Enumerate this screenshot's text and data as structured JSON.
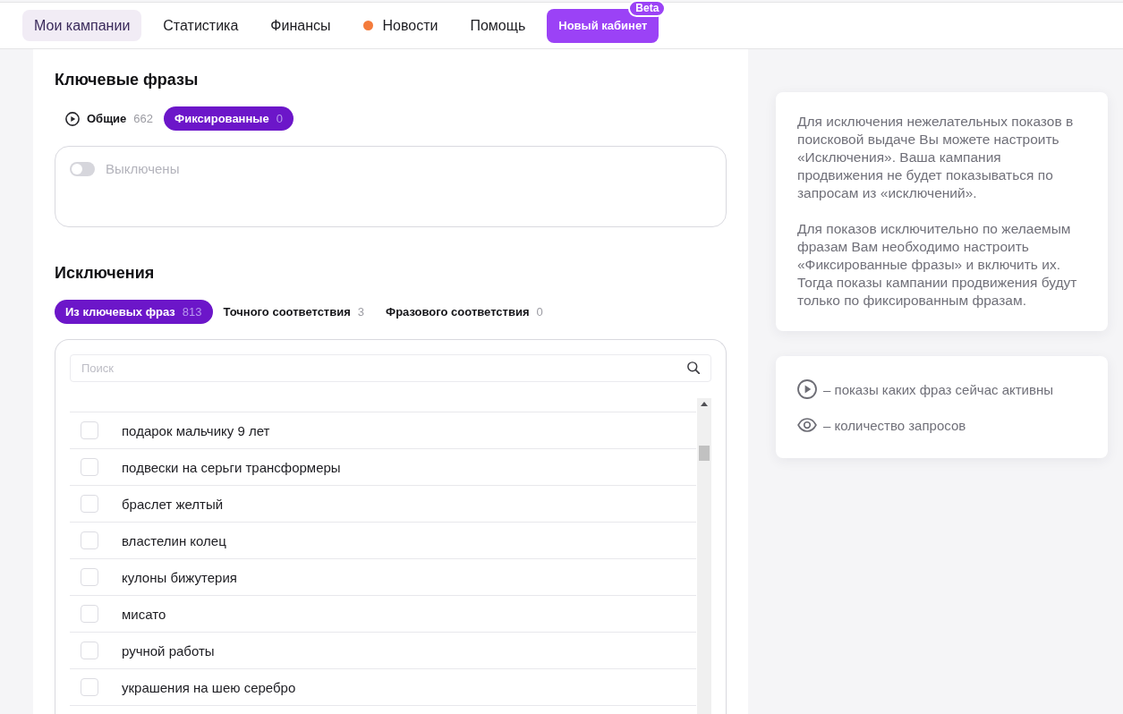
{
  "nav": {
    "items": [
      {
        "label": "Мои кампании",
        "selected": true,
        "dot": false
      },
      {
        "label": "Статистика",
        "selected": false,
        "dot": false
      },
      {
        "label": "Финансы",
        "selected": false,
        "dot": false
      },
      {
        "label": "Новости",
        "selected": false,
        "dot": true
      },
      {
        "label": "Помощь",
        "selected": false,
        "dot": false
      }
    ],
    "button": {
      "label": "Новый кабинет",
      "badge": "Beta"
    }
  },
  "keywords": {
    "title": "Ключевые фразы",
    "tabs": [
      {
        "label": "Общие",
        "count": "662",
        "active": true,
        "selected": false
      },
      {
        "label": "Фиксированные",
        "count": "0",
        "active": false,
        "selected": true
      }
    ],
    "toggle": {
      "label": "Выключены",
      "on": false
    }
  },
  "exclusions": {
    "title": "Исключения",
    "tabs": [
      {
        "label": "Из ключевых фраз",
        "count": "813",
        "selected": true
      },
      {
        "label": "Точного соответствия",
        "count": "3",
        "selected": false
      },
      {
        "label": "Фразового соответствия",
        "count": "0",
        "selected": false
      }
    ],
    "search": {
      "placeholder": "Поиск"
    },
    "rows": [
      {
        "text": "подарок мальчику 9 лет",
        "checked": false
      },
      {
        "text": "подвески на серьги трансформеры",
        "checked": false
      },
      {
        "text": "браслет желтый",
        "checked": false
      },
      {
        "text": "властелин колец",
        "checked": false
      },
      {
        "text": "кулоны бижутерия",
        "checked": false
      },
      {
        "text": "мисато",
        "checked": false
      },
      {
        "text": "ручной работы",
        "checked": false
      },
      {
        "text": "украшения на шею серебро",
        "checked": false
      }
    ]
  },
  "info_card": {
    "paragraphs": [
      "Для исключения нежелательных показов в поисковой выдаче Вы можете настроить «Исключения». Ваша кампания продвижения не будет показываться по запросам из «исключений».",
      "Для показов исключительно по желаемым фразам Вам необходимо настроить «Фиксированные фразы» и включить их. Тогда показы кампании продвижения будут только по фиксированным фразам."
    ]
  },
  "legend": {
    "items": [
      {
        "kind": "play",
        "text": "– показы каких фраз сейчас активны"
      },
      {
        "kind": "eye",
        "text": "– количество запросов"
      }
    ]
  }
}
